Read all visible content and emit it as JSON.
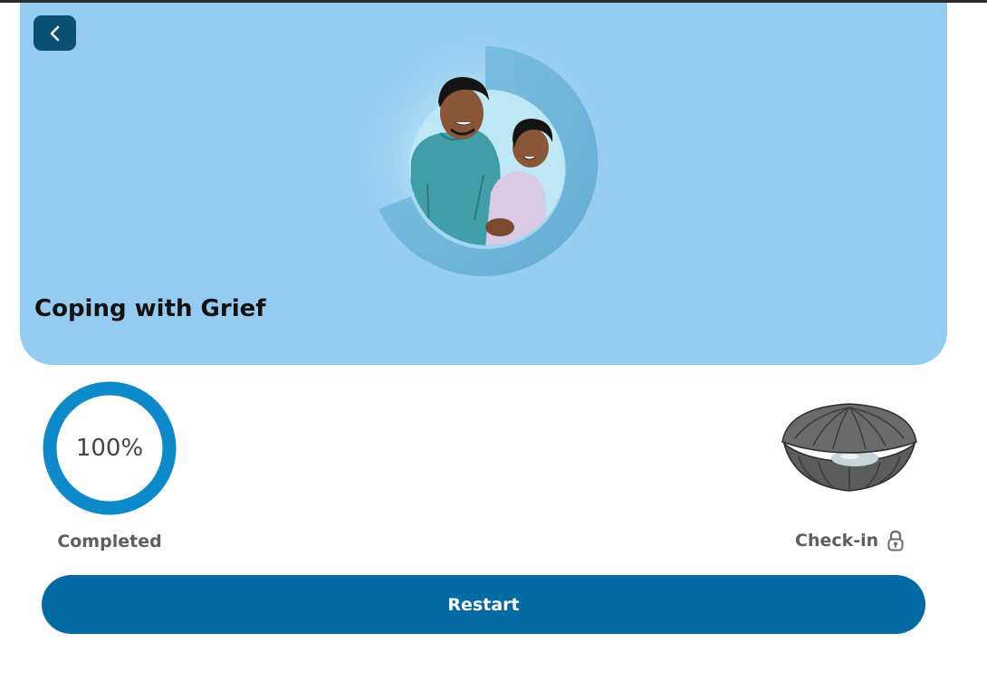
{
  "header": {
    "back_icon": "chevron-left-icon",
    "title": "Coping with Grief",
    "background_color": "#93ccf0",
    "back_button_color": "#0a4f74"
  },
  "progress": {
    "value": "100%",
    "fraction": 1.0,
    "label": "Completed",
    "ring_color": "#0d8ac9"
  },
  "checkin": {
    "label": "Check-in",
    "icon": "lock-icon",
    "image": "clam-shell-with-pearl"
  },
  "actions": {
    "restart_label": "Restart",
    "restart_color": "#046aa4"
  }
}
